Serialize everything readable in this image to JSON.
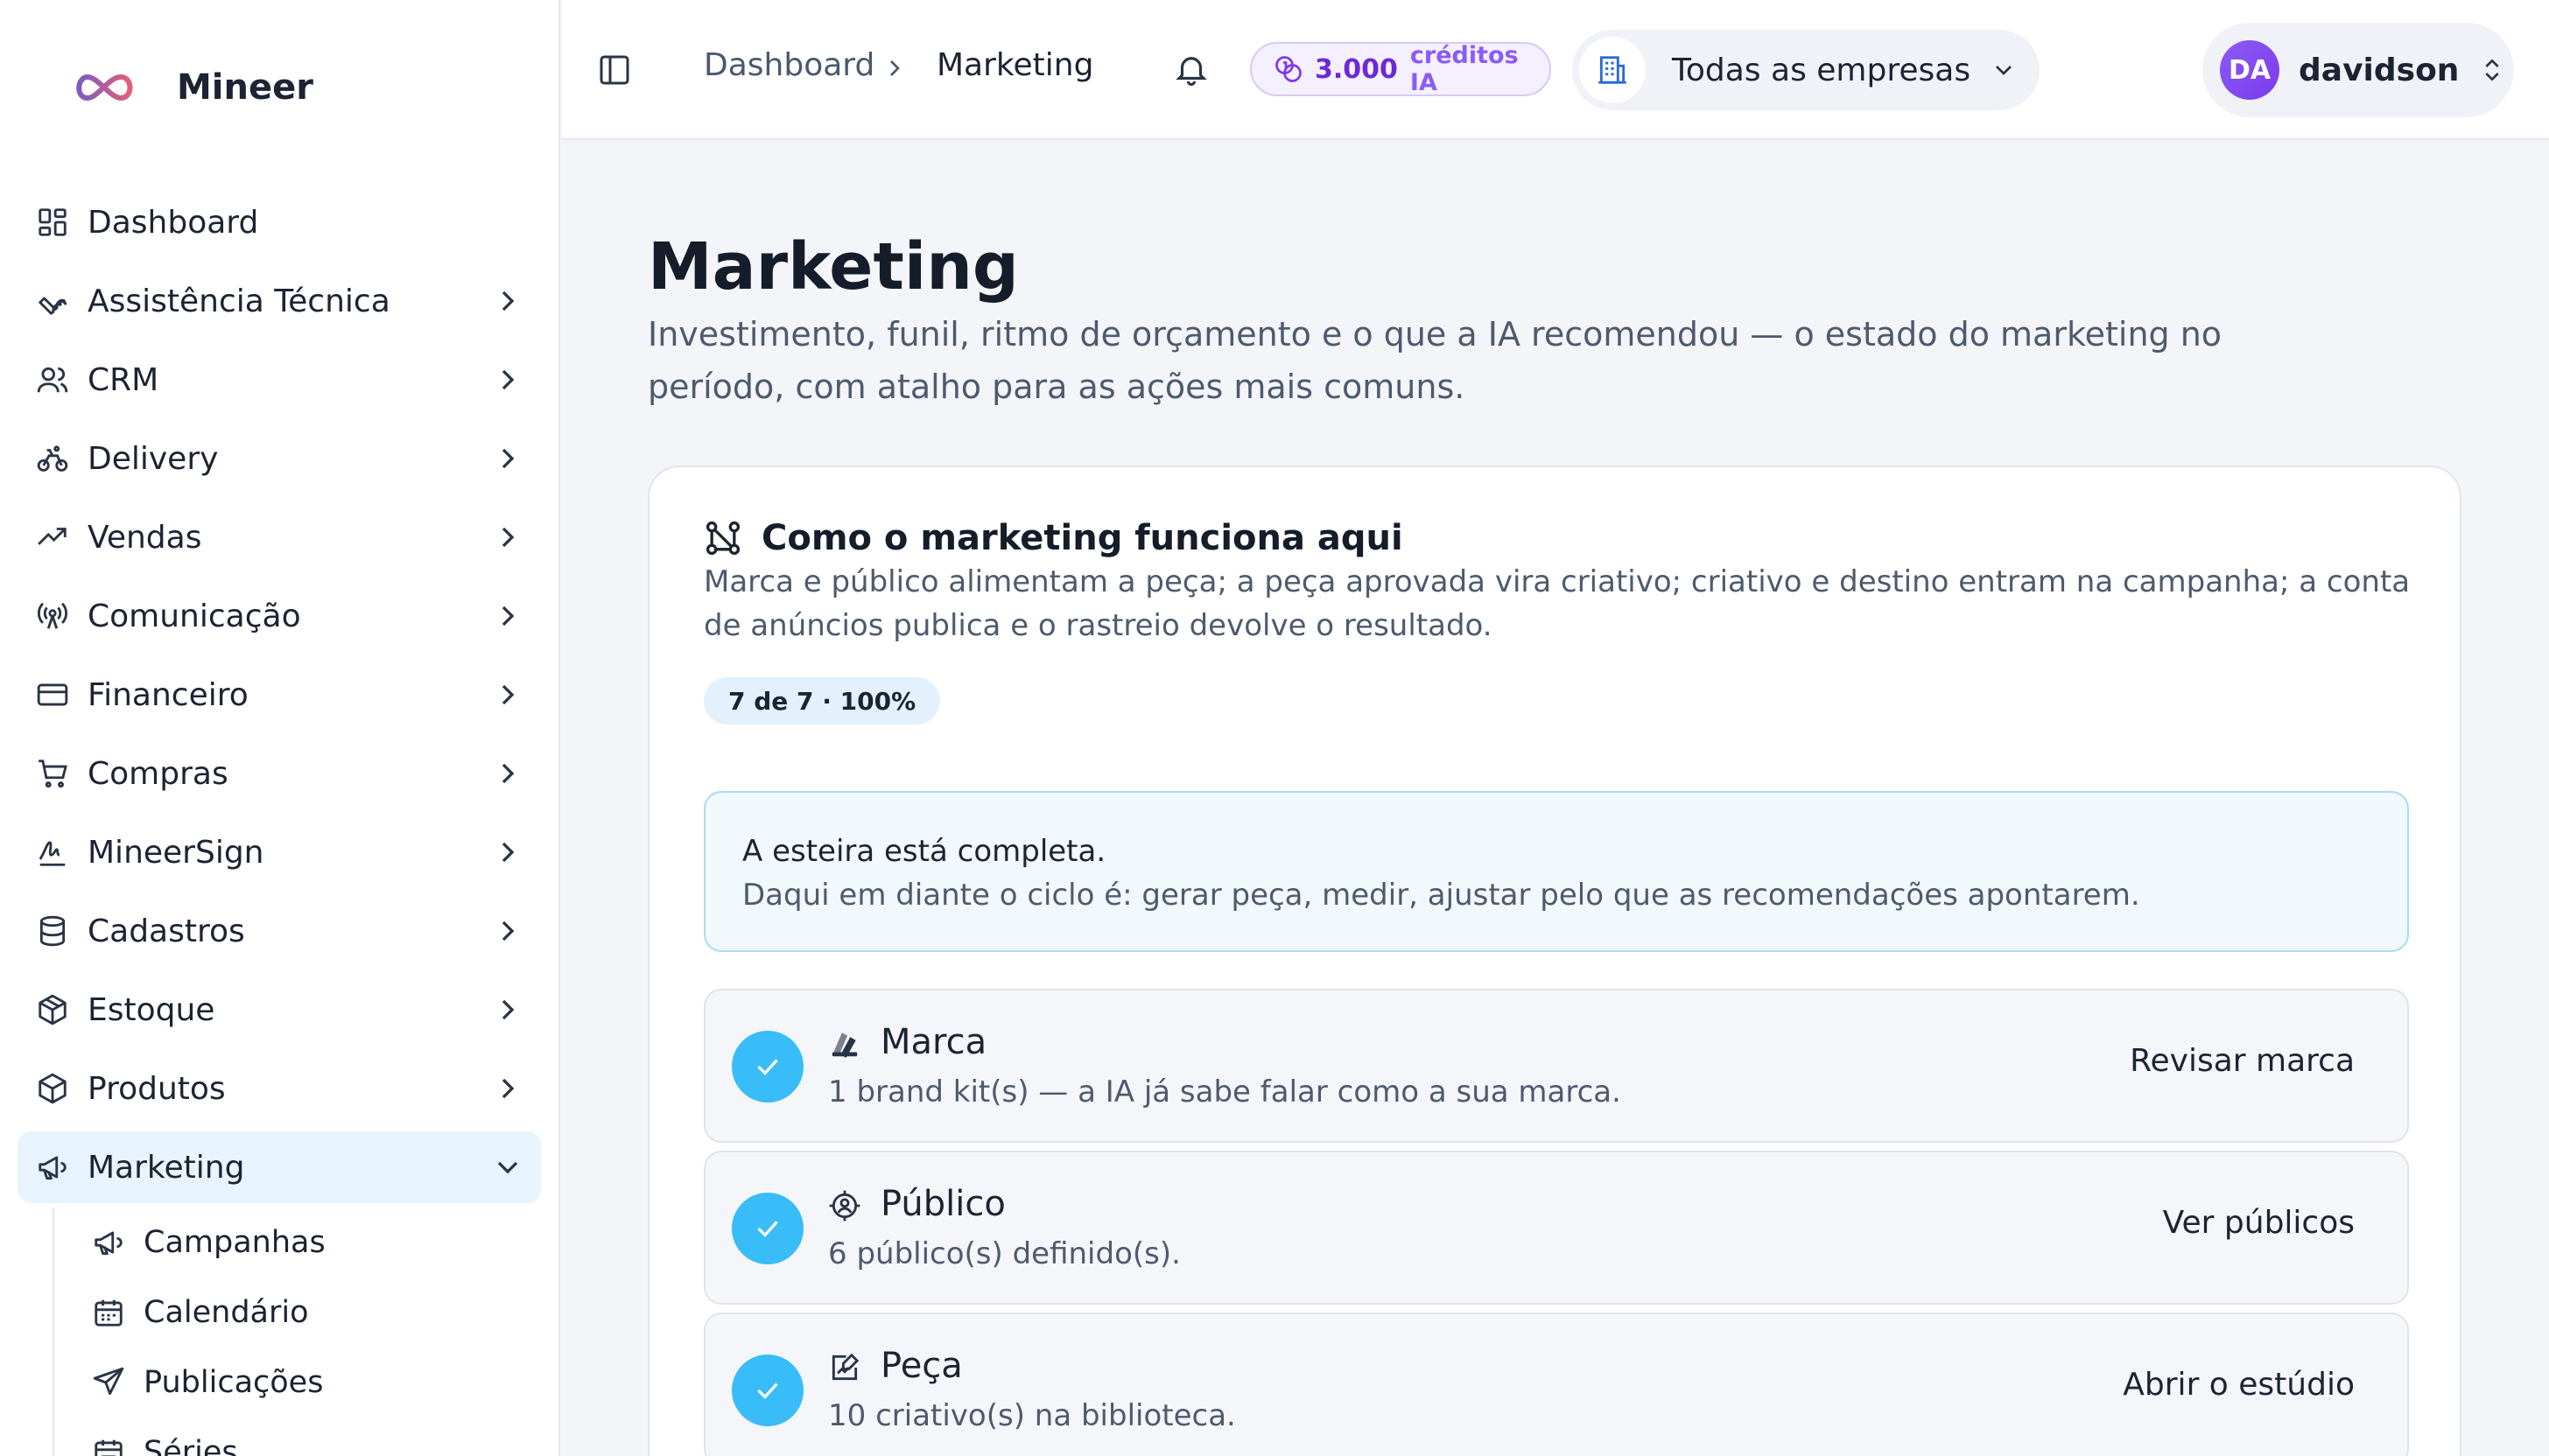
{
  "brand": {
    "name": "Mineer",
    "logo_icon": "infinity-logo"
  },
  "sidebar": {
    "items": [
      {
        "label": "Dashboard",
        "icon": "grid-icon"
      },
      {
        "label": "Assistência Técnica",
        "icon": "wrench-icon"
      },
      {
        "label": "CRM",
        "icon": "users-icon"
      },
      {
        "label": "Delivery",
        "icon": "bike-icon"
      },
      {
        "label": "Vendas",
        "icon": "trending-up-icon"
      },
      {
        "label": "Comunicação",
        "icon": "broadcast-icon"
      },
      {
        "label": "Financeiro",
        "icon": "credit-card-icon"
      },
      {
        "label": "Compras",
        "icon": "cart-icon"
      },
      {
        "label": "MineerSign",
        "icon": "signature-icon"
      },
      {
        "label": "Cadastros",
        "icon": "database-icon"
      },
      {
        "label": "Estoque",
        "icon": "package-icon"
      },
      {
        "label": "Produtos",
        "icon": "box-icon"
      },
      {
        "label": "Marketing",
        "icon": "megaphone-icon",
        "active": true
      }
    ],
    "subitems": [
      {
        "label": "Campanhas",
        "icon": "megaphone-icon"
      },
      {
        "label": "Calendário",
        "icon": "calendar-icon"
      },
      {
        "label": "Publicações",
        "icon": "send-icon"
      },
      {
        "label": "Séries",
        "icon": "calendar-range-icon"
      }
    ]
  },
  "topbar": {
    "breadcrumb": [
      "Dashboard",
      "Marketing"
    ],
    "credits": {
      "amount": "3.000",
      "unit": "créditos IA"
    },
    "company_selector": "Todas as empresas",
    "user": {
      "initials": "DA",
      "name": "davidson"
    }
  },
  "main": {
    "title": "Marketing",
    "description": "Investimento, funil, ritmo de orçamento e o que a IA recomendou — o estado do marketing no período, com atalho para as ações mais comuns."
  },
  "card": {
    "title": "Como o marketing funciona aqui",
    "description": "Marca e público alimentam a peça; a peça aprovada vira criativo; criativo e destino entram na campanha; a conta de anúncios publica e o rastreio devolve o resultado.",
    "progress": "7 de 7 · 100%",
    "notice": {
      "title": "A esteira está completa.",
      "text": "Daqui em diante o ciclo é: gerar peça, medir, ajustar pelo que as recomendações apontarem."
    },
    "steps": [
      {
        "title": "Marca",
        "subtitle": "1 brand kit(s) — a IA já sabe falar como a sua marca.",
        "action": "Revisar marca",
        "icon": "palette-icon"
      },
      {
        "title": "Público",
        "subtitle": "6 público(s) definido(s).",
        "action": "Ver públicos",
        "icon": "target-user-icon"
      },
      {
        "title": "Peça",
        "subtitle": "10 criativo(s) na biblioteca.",
        "action": "Abrir o estúdio",
        "icon": "edit-image-icon"
      }
    ]
  },
  "colors": {
    "accent": "#38bdf8",
    "active_bg": "#e8f4fd",
    "credits": "#7c3aed"
  }
}
